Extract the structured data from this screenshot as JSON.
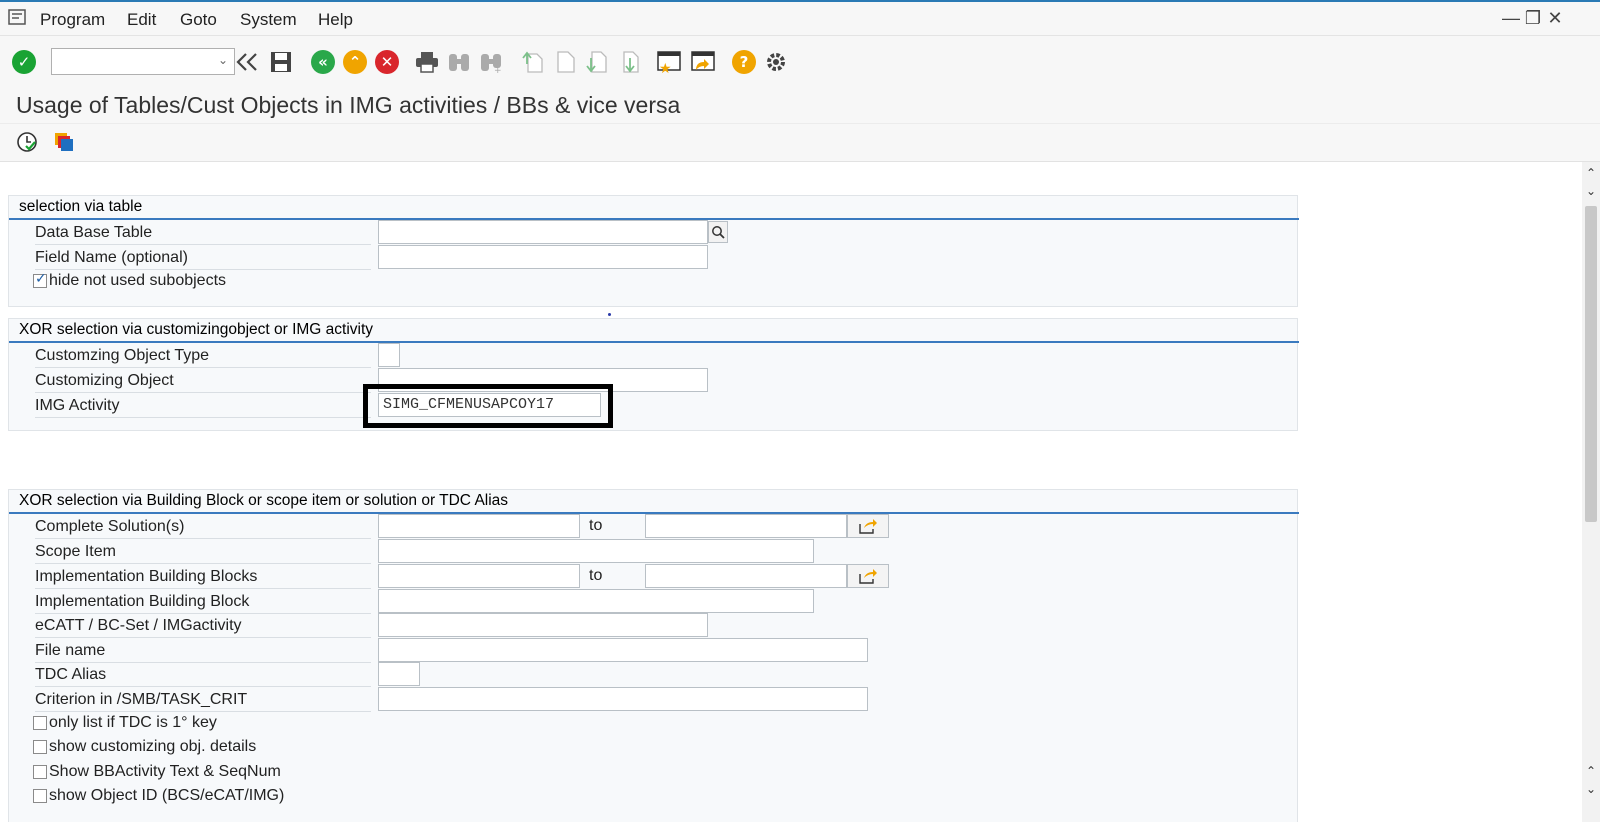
{
  "menu": {
    "items": [
      {
        "label": "Program"
      },
      {
        "label": "Edit"
      },
      {
        "label": "Goto"
      },
      {
        "label": "System"
      },
      {
        "label": "Help"
      }
    ]
  },
  "window_controls": {
    "minimize": "—",
    "restore": "❐",
    "close": "✕"
  },
  "toolbar": {
    "command_field_value": "",
    "icons": [
      "enter-icon",
      "back-navigate-icon",
      "save-icon",
      "back-icon",
      "exit-icon",
      "cancel-icon",
      "print-icon",
      "find-icon",
      "find-next-icon",
      "first-page-icon",
      "previous-page-icon",
      "next-page-icon",
      "last-page-icon",
      "create-session-icon",
      "create-shortcut-icon",
      "help-icon",
      "settings-icon"
    ]
  },
  "page": {
    "title": "Usage of Tables/Cust Objects in IMG activities / BBs & vice versa"
  },
  "app_toolbar": {
    "icons": [
      "execute-icon",
      "get-variant-icon"
    ]
  },
  "groups": {
    "table": {
      "title": "selection via table",
      "fields": {
        "db_table": {
          "label": "Data Base Table",
          "value": ""
        },
        "field_name": {
          "label": "Field Name (optional)",
          "value": ""
        }
      },
      "hide_unused": {
        "label": "hide not used subobjects",
        "checked": true
      }
    },
    "xor_cust": {
      "title": "XOR selection via customizingobject or IMG activity",
      "fields": {
        "obj_type": {
          "label": "Customzing Object Type",
          "value": ""
        },
        "cust_obj": {
          "label": "Customizing Object",
          "value": ""
        },
        "img_activity": {
          "label": "IMG Activity",
          "value": "SIMG_CFMENUSAPCOY17"
        }
      }
    },
    "xor_bb": {
      "title": "XOR selection via Building Block or scope item or solution or TDC Alias",
      "to_label": "to",
      "fields": {
        "complete_solutions": {
          "label": "Complete Solution(s)",
          "from": "",
          "to": ""
        },
        "scope_item": {
          "label": "Scope Item",
          "value": ""
        },
        "impl_bbs": {
          "label": "Implementation Building Blocks",
          "from": "",
          "to": ""
        },
        "impl_bb": {
          "label": "Implementation Building Block",
          "value": ""
        },
        "ecatt": {
          "label": "eCATT / BC-Set / IMGactivity",
          "value": ""
        },
        "file_name": {
          "label": "File name",
          "value": ""
        },
        "tdc_alias": {
          "label": "TDC Alias",
          "value": ""
        },
        "criterion": {
          "label": "Criterion in /SMB/TASK_CRIT",
          "value": ""
        }
      },
      "checkboxes": {
        "tdc_key": {
          "label": "only list if TDC is 1° key",
          "checked": false
        },
        "cust_details": {
          "label": "show customizing obj. details",
          "checked": false
        },
        "bbactivity": {
          "label": "Show BBActivity Text & SeqNum",
          "checked": false
        },
        "object_id": {
          "label": "show Object ID (BCS/eCAT/IMG)",
          "checked": false
        }
      }
    }
  },
  "colors": {
    "accent": "#3a7abf",
    "enter_green": "#1aa334",
    "back_green": "#2aa84a",
    "exit_orange": "#f0a400",
    "cancel_red": "#d9262c",
    "help_orange": "#f0a400"
  }
}
